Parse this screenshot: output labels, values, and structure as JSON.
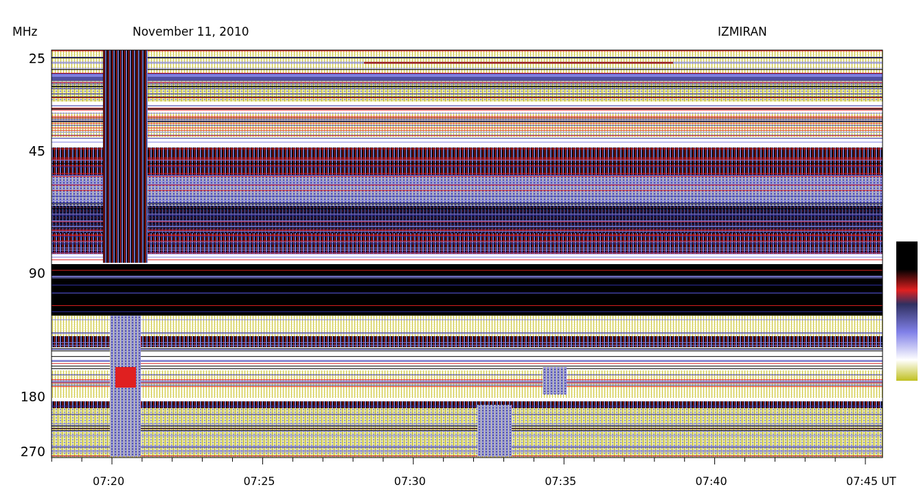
{
  "header": {
    "unit": "MHz",
    "date": "November 11, 2010",
    "observatory": "IZMIRAN"
  },
  "y_ticks": [
    "25",
    "45",
    "90",
    "180",
    "270"
  ],
  "x_ticks": [
    "07:20",
    "07:25",
    "07:30",
    "07:35",
    "07:40",
    "07:45 UT"
  ]
}
